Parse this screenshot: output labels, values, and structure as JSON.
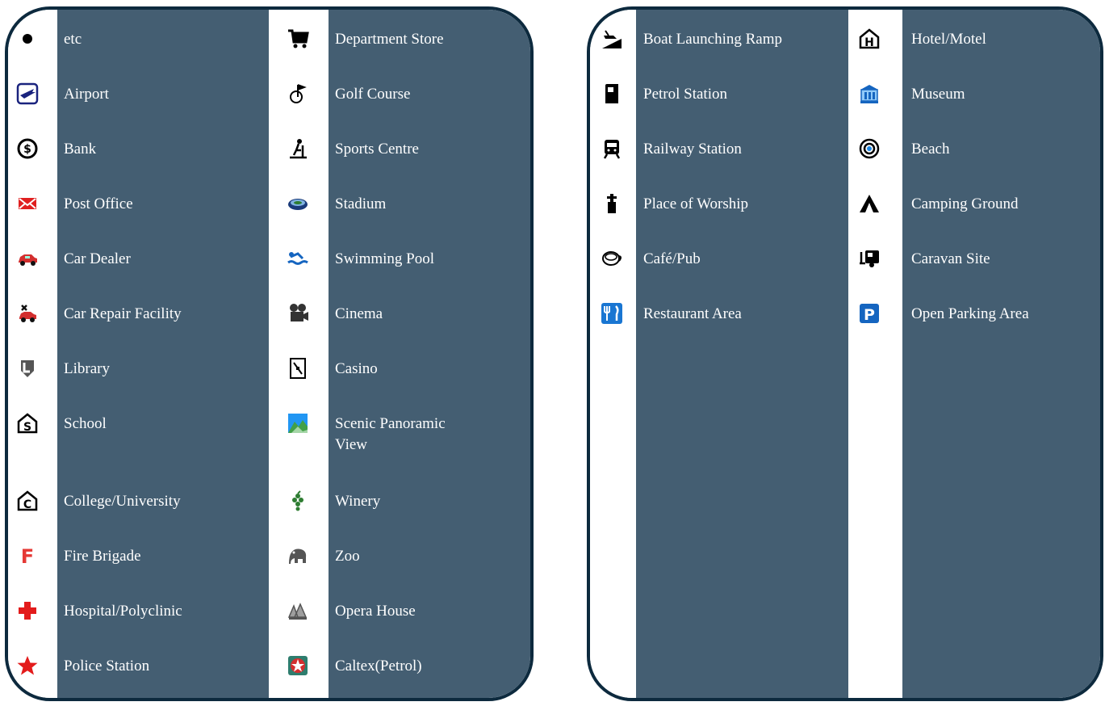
{
  "left_panel": {
    "columns": [
      {
        "items": [
          {
            "label": "etc",
            "icon": "bullet-dot-icon"
          },
          {
            "label": "Airport",
            "icon": "airplane-icon"
          },
          {
            "label": "Bank",
            "icon": "dollar-coin-icon"
          },
          {
            "label": "Post Office",
            "icon": "envelope-icon"
          },
          {
            "label": "Car Dealer",
            "icon": "red-car-icon"
          },
          {
            "label": "Car Repair Facility",
            "icon": "car-repair-icon"
          },
          {
            "label": "Library",
            "icon": "library-shield-icon"
          },
          {
            "label": "School",
            "icon": "school-house-s-icon"
          },
          {
            "label": "College/University",
            "icon": "college-house-c-icon"
          },
          {
            "label": "Fire Brigade",
            "icon": "letter-f-icon"
          },
          {
            "label": "Hospital/Polyclinic",
            "icon": "red-cross-icon"
          },
          {
            "label": "Police Station",
            "icon": "red-star-icon"
          }
        ]
      },
      {
        "items": [
          {
            "label": "Department Store",
            "icon": "shopping-cart-icon"
          },
          {
            "label": "Golf Course",
            "icon": "golf-flag-icon"
          },
          {
            "label": "Sports Centre",
            "icon": "sports-figure-icon"
          },
          {
            "label": "Stadium",
            "icon": "stadium-icon"
          },
          {
            "label": "Swimming Pool",
            "icon": "swimmer-icon"
          },
          {
            "label": "Cinema",
            "icon": "film-camera-icon"
          },
          {
            "label": "Casino",
            "icon": "playing-card-icon"
          },
          {
            "label": "Scenic Panoramic View",
            "icon": "green-landscape-icon"
          },
          {
            "label": "Winery",
            "icon": "grapes-icon"
          },
          {
            "label": "Zoo",
            "icon": "elephant-icon"
          },
          {
            "label": "Opera House",
            "icon": "opera-house-icon"
          },
          {
            "label": "Caltex(Petrol)",
            "icon": "caltex-star-icon"
          }
        ]
      }
    ]
  },
  "right_panel": {
    "columns": [
      {
        "items": [
          {
            "label": "Boat Launching Ramp",
            "icon": "boat-ramp-icon"
          },
          {
            "label": "Petrol Station",
            "icon": "fuel-pump-icon"
          },
          {
            "label": "Railway Station",
            "icon": "train-icon"
          },
          {
            "label": "Place of Worship",
            "icon": "church-cross-icon"
          },
          {
            "label": "Café/Pub",
            "icon": "coffee-cup-icon"
          },
          {
            "label": "Restaurant Area",
            "icon": "fork-knife-icon"
          }
        ]
      },
      {
        "items": [
          {
            "label": "Hotel/Motel",
            "icon": "hotel-house-h-icon"
          },
          {
            "label": "Museum",
            "icon": "museum-building-icon"
          },
          {
            "label": "Beach",
            "icon": "life-ring-icon"
          },
          {
            "label": "Camping Ground",
            "icon": "tent-icon"
          },
          {
            "label": "Caravan Site",
            "icon": "caravan-icon"
          },
          {
            "label": "Open Parking Area",
            "icon": "parking-p-icon"
          }
        ]
      }
    ]
  }
}
